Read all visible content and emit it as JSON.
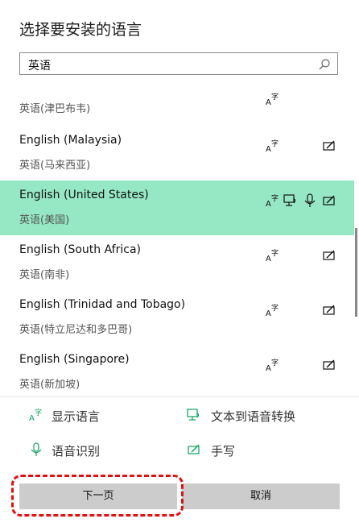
{
  "title": "选择要安装的语言",
  "search": {
    "value": "英语"
  },
  "list": {
    "partial_sub": "英语(津巴布韦)",
    "items": [
      {
        "name": "English (Malaysia)",
        "sub": "英语(马来西亚)"
      },
      {
        "name": "English (United States)",
        "sub": "英语(美国)"
      },
      {
        "name": "English (South Africa)",
        "sub": "英语(南非)"
      },
      {
        "name": "English (Trinidad and Tobago)",
        "sub": "英语(特立尼达和多巴哥)"
      },
      {
        "name": "English (Singapore)",
        "sub": "英语(新加坡)"
      }
    ]
  },
  "legend": {
    "display_lang": "显示语言",
    "tts": "文本到语音转换",
    "speech": "语音识别",
    "handwriting": "手写"
  },
  "buttons": {
    "next": "下一页",
    "cancel": "取消"
  },
  "colors": {
    "selected_bg": "#95e8c3",
    "accent_green": "#10a060",
    "highlight": "#e01010"
  }
}
